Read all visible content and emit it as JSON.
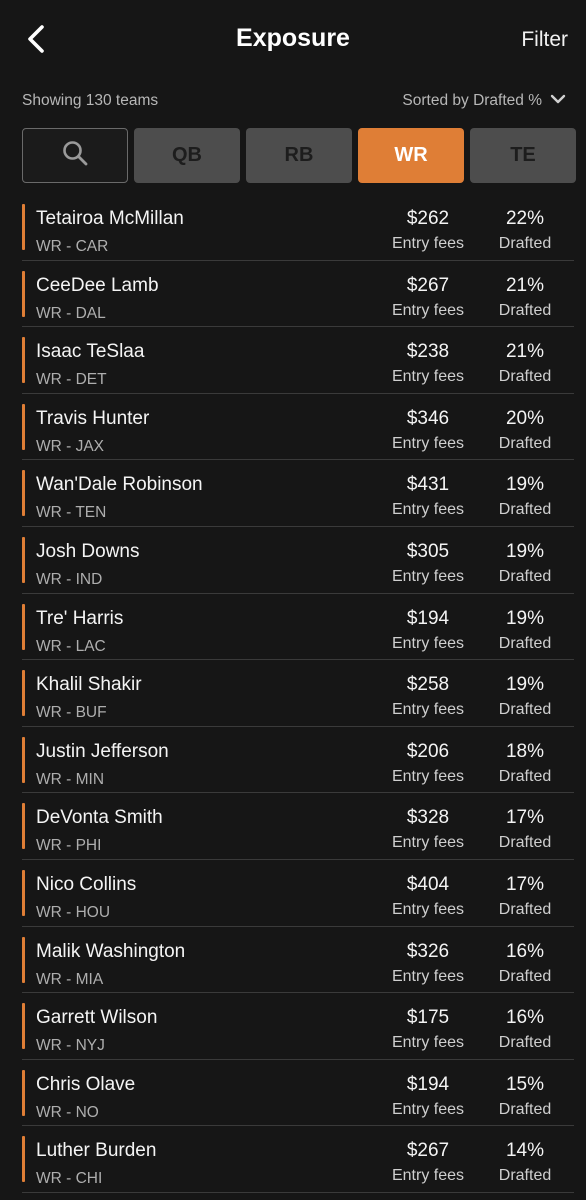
{
  "header": {
    "title": "Exposure",
    "filter_label": "Filter",
    "back_icon": "chevron-left-icon"
  },
  "summary": {
    "showing_text": "Showing 130 teams",
    "sort_text": "Sorted by Drafted %",
    "sort_icon": "chevron-down-icon"
  },
  "tabs": {
    "search_icon": "search-icon",
    "items": [
      {
        "label": "QB",
        "active": false
      },
      {
        "label": "RB",
        "active": false
      },
      {
        "label": "WR",
        "active": true
      },
      {
        "label": "TE",
        "active": false
      }
    ]
  },
  "colors": {
    "accent": "#df7e36",
    "background": "#161616",
    "tab_inactive": "#4d4d4d"
  },
  "players": [
    {
      "name": "Tetairoa McMillan",
      "position": "WR - CAR",
      "fee": "$262",
      "fee_label": "Entry fees",
      "pct": "22%",
      "pct_label": "Drafted"
    },
    {
      "name": "CeeDee Lamb",
      "position": "WR - DAL",
      "fee": "$267",
      "fee_label": "Entry fees",
      "pct": "21%",
      "pct_label": "Drafted"
    },
    {
      "name": "Isaac TeSlaa",
      "position": "WR - DET",
      "fee": "$238",
      "fee_label": "Entry fees",
      "pct": "21%",
      "pct_label": "Drafted"
    },
    {
      "name": "Travis Hunter",
      "position": "WR - JAX",
      "fee": "$346",
      "fee_label": "Entry fees",
      "pct": "20%",
      "pct_label": "Drafted"
    },
    {
      "name": "Wan'Dale Robinson",
      "position": "WR - TEN",
      "fee": "$431",
      "fee_label": "Entry fees",
      "pct": "19%",
      "pct_label": "Drafted"
    },
    {
      "name": "Josh Downs",
      "position": "WR - IND",
      "fee": "$305",
      "fee_label": "Entry fees",
      "pct": "19%",
      "pct_label": "Drafted"
    },
    {
      "name": "Tre' Harris",
      "position": "WR - LAC",
      "fee": "$194",
      "fee_label": "Entry fees",
      "pct": "19%",
      "pct_label": "Drafted"
    },
    {
      "name": "Khalil Shakir",
      "position": "WR - BUF",
      "fee": "$258",
      "fee_label": "Entry fees",
      "pct": "19%",
      "pct_label": "Drafted"
    },
    {
      "name": "Justin Jefferson",
      "position": "WR - MIN",
      "fee": "$206",
      "fee_label": "Entry fees",
      "pct": "18%",
      "pct_label": "Drafted"
    },
    {
      "name": "DeVonta Smith",
      "position": "WR - PHI",
      "fee": "$328",
      "fee_label": "Entry fees",
      "pct": "17%",
      "pct_label": "Drafted"
    },
    {
      "name": "Nico Collins",
      "position": "WR - HOU",
      "fee": "$404",
      "fee_label": "Entry fees",
      "pct": "17%",
      "pct_label": "Drafted"
    },
    {
      "name": "Malik Washington",
      "position": "WR - MIA",
      "fee": "$326",
      "fee_label": "Entry fees",
      "pct": "16%",
      "pct_label": "Drafted"
    },
    {
      "name": "Garrett Wilson",
      "position": "WR - NYJ",
      "fee": "$175",
      "fee_label": "Entry fees",
      "pct": "16%",
      "pct_label": "Drafted"
    },
    {
      "name": "Chris Olave",
      "position": "WR - NO",
      "fee": "$194",
      "fee_label": "Entry fees",
      "pct": "15%",
      "pct_label": "Drafted"
    },
    {
      "name": "Luther Burden",
      "position": "WR - CHI",
      "fee": "$267",
      "fee_label": "Entry fees",
      "pct": "14%",
      "pct_label": "Drafted"
    }
  ]
}
